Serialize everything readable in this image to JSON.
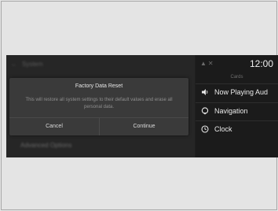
{
  "settings": {
    "header": "System",
    "row_label": "Advanced Options"
  },
  "dialog": {
    "title": "Factory Data Reset",
    "message": "This will restore all system settings to their default values and erase all personal data.",
    "cancel_label": "Cancel",
    "continue_label": "Continue"
  },
  "status_bar": {
    "time": "12:00",
    "icons": [
      "signal-icon",
      "no-bluetooth-icon"
    ]
  },
  "cards_panel": {
    "title": "Cards",
    "items": [
      {
        "label": "Now Playing Aud",
        "icon": "speaker-icon"
      },
      {
        "label": "Navigation",
        "icon": "navigation-pin-icon"
      },
      {
        "label": "Clock",
        "icon": "clock-icon"
      }
    ]
  }
}
